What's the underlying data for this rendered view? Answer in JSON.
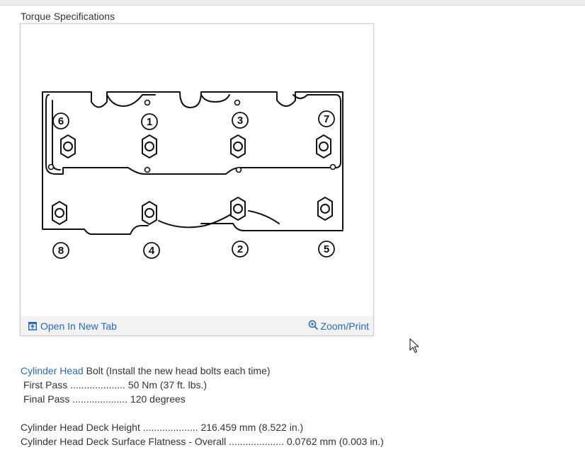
{
  "section_title": "Torque Specifications",
  "figure": {
    "open_label": "Open In New Tab",
    "zoom_label": "Zoom/Print",
    "bolt_numbers": [
      "1",
      "2",
      "3",
      "4",
      "5",
      "6",
      "7",
      "8"
    ]
  },
  "specs": {
    "head_link": "Cylinder Head",
    "head_rest": "Bolt (Install the new head bolts each time)",
    "first_pass_label": "First Pass",
    "first_pass_dots": "....................",
    "first_pass_value": "50 Nm (37 ft. lbs.)",
    "final_pass_label": "Final Pass",
    "final_pass_dots": "....................",
    "final_pass_value": "120 degrees",
    "deck_height_label": "Cylinder Head Deck Height",
    "deck_height_dots": "....................",
    "deck_height_value": "216.459 mm (8.522 in.)",
    "flatness_label": "Cylinder Head Deck Surface Flatness - Overall",
    "flatness_dots": "....................",
    "flatness_value": "0.0762 mm (0.003 in.)"
  },
  "colors": {
    "link": "#2a6ab0",
    "text": "#333333",
    "toolbar_bg": "#f2f2f2"
  },
  "icons": {
    "open": "open-in-new-tab-icon",
    "zoom": "zoom-in-icon"
  }
}
